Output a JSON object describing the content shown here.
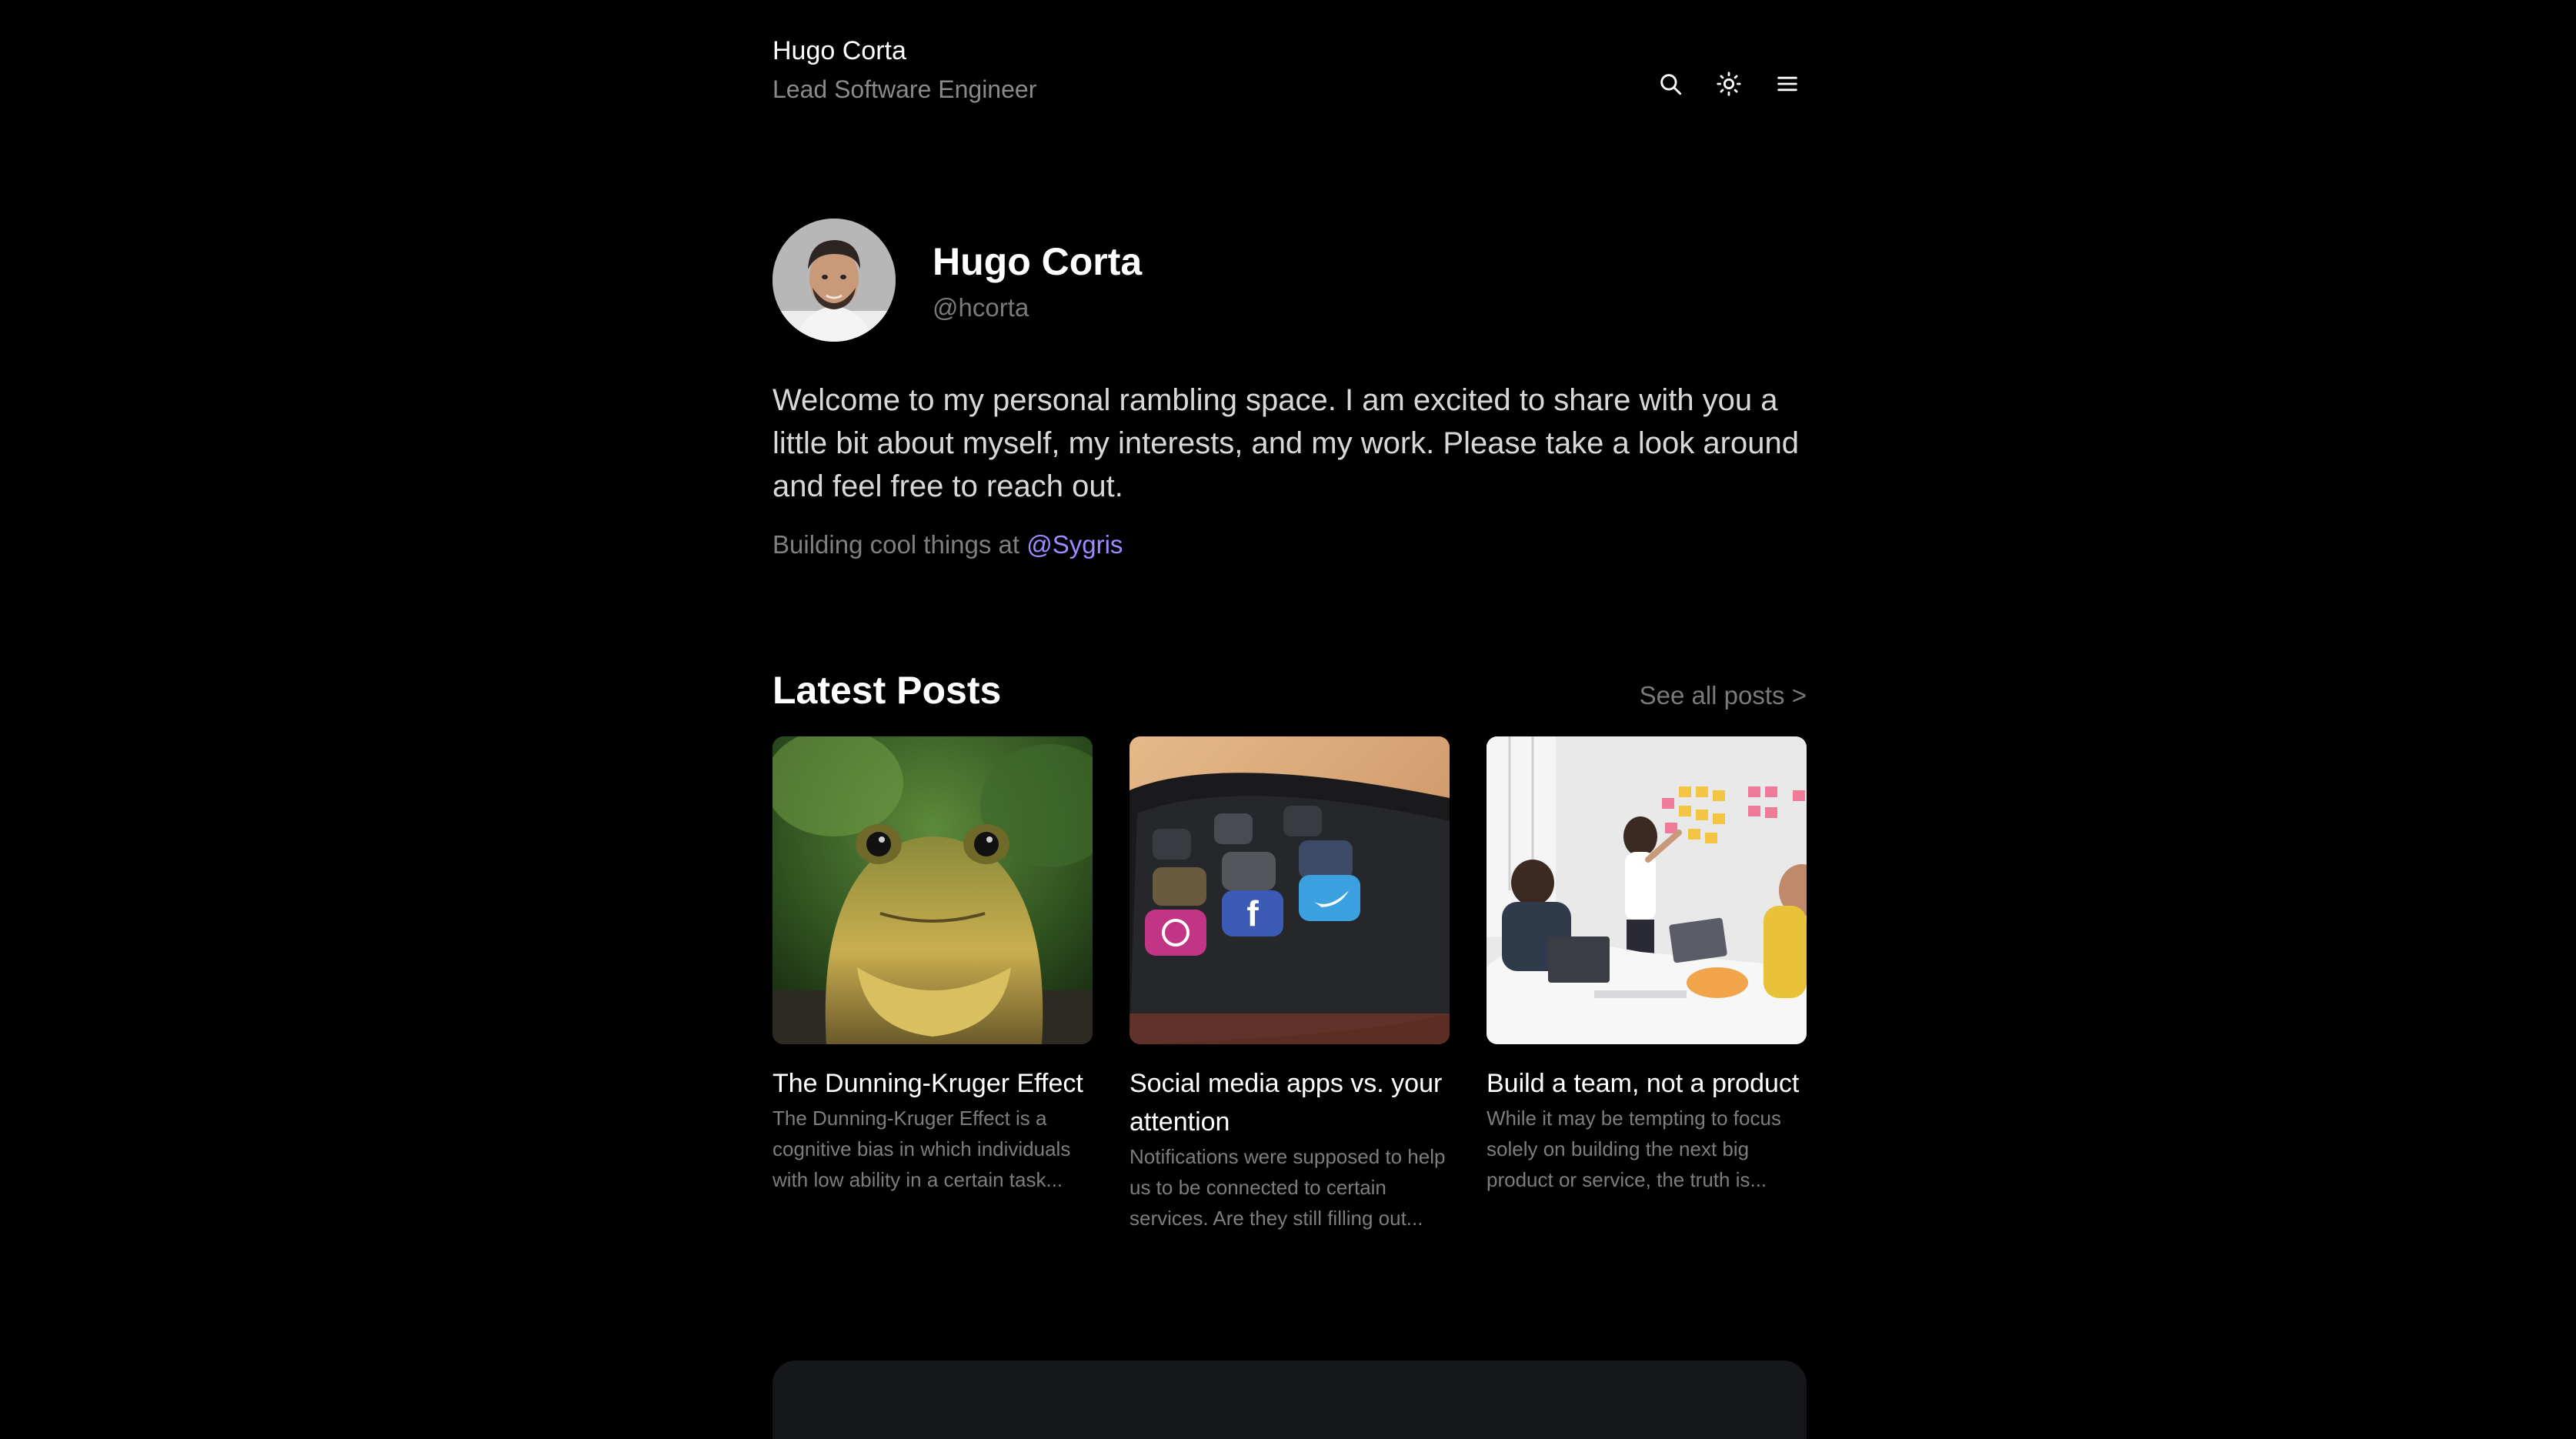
{
  "header": {
    "site_name": "Hugo Corta",
    "site_role": "Lead Software Engineer",
    "icons": [
      "search-icon",
      "sun-icon",
      "menu-icon"
    ]
  },
  "profile": {
    "name": "Hugo Corta",
    "handle": "@hcorta",
    "intro": "Welcome to my personal rambling space. I am excited to share with you a little bit about myself, my interests, and my work. Please take a look around and feel free to reach out.",
    "building_prefix": "Building cool things at ",
    "building_link": "@Sygris"
  },
  "latest": {
    "title": "Latest Posts",
    "see_all": "See all posts >",
    "posts": [
      {
        "title": "The Dunning-Kruger Effect",
        "description": "The Dunning-Kruger Effect is a cognitive bias in which individuals with low ability in a certain task..."
      },
      {
        "title": "Social media apps vs. your attention",
        "description": "Notifications were supposed to help us to be connected to certain services. Are they still filling out..."
      },
      {
        "title": "Build a team, not a product",
        "description": "While it may be tempting to focus solely on building the next big product or service, the truth is..."
      }
    ]
  },
  "colors": {
    "background": "#000000",
    "accent_link": "#9b8cff",
    "muted_text": "#7a7a7a",
    "footer_card": "#16171a"
  }
}
